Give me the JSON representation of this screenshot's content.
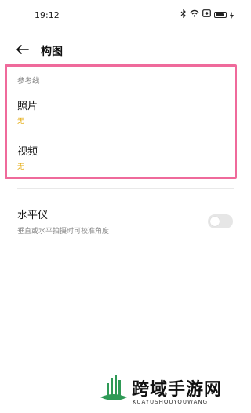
{
  "status_bar": {
    "time": "19:12",
    "icons": [
      "bluetooth-icon",
      "wifi-icon",
      "screen-record-icon",
      "battery-icon",
      "charging-icon"
    ]
  },
  "header": {
    "title": "构图",
    "back_icon": "arrow-left-icon"
  },
  "reference_lines": {
    "section_label": "参考线",
    "items": [
      {
        "title": "照片",
        "value": "无"
      },
      {
        "title": "视频",
        "value": "无"
      }
    ]
  },
  "level": {
    "title": "水平仪",
    "description": "垂直或水平拍摄时可校准角度",
    "enabled": false
  },
  "watermark": {
    "text": "跨域手游网",
    "subtext": "KUAYUSHOUYOUWANG"
  },
  "colors": {
    "highlight_border": "#ef6a9b",
    "value_accent": "#e3a600",
    "watermark_green": "#2f9a56"
  }
}
